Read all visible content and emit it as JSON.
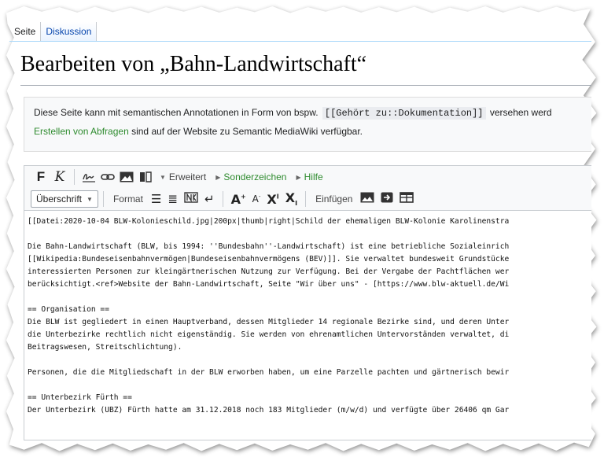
{
  "tabs": [
    {
      "label": "Seite"
    },
    {
      "label": "Diskussion"
    }
  ],
  "page_title": "Bearbeiten von „Bahn-Landwirtschaft“",
  "notice": {
    "line1_before": "Diese Seite kann mit semantischen Annotationen in Form von bspw.",
    "line1_code": "[[Gehört zu::Dokumentation]]",
    "line1_after": "versehen werd",
    "line2_link": "Erstellen von Abfragen",
    "line2_rest": "sind auf der Website zu Semantic MediaWiki verfügbar."
  },
  "toolbar": {
    "bold": "F",
    "italic": "K",
    "advanced": "Erweitert",
    "special_chars": "Sonderzeichen",
    "help": "Hilfe",
    "heading_select": "Überschrift",
    "format": "Format",
    "insert": "Einfügen"
  },
  "editor_lines": [
    "[[Datei:2020-10-04 BLW-Kolonieschild.jpg|200px|thumb|right|Schild der ehemaligen BLW-Kolonie Karolinenstra",
    "",
    "Die Bahn-Landwirtschaft (BLW, bis 1994: ''Bundesbahn''-Landwirtschaft) ist eine betriebliche Sozialeinrich",
    "[[Wikipedia:Bundeseisenbahnvermögen|Bundeseisenbahnvermögens (BEV)]]. Sie verwaltet bundesweit Grundstücke",
    "interessierten Personen zur kleingärtnerischen Nutzung zur Verfügung. Bei der Vergabe der Pachtflächen wer",
    "berücksichtigt.<ref>Website der Bahn-Landwirtschaft, Seite \"Wir über uns\" - [https://www.blw-aktuell.de/Wi",
    "",
    "== Organisation ==",
    "Die BLW ist gegliedert in einen Hauptverband, dessen Mitglieder 14 regionale Bezirke sind, und deren Unter",
    "die Unterbezirke rechtlich nicht eigenständig. Sie werden von ehrenamtlichen Untervorständen verwaltet, di",
    "Beitragswesen, Streitschlichtung).",
    "",
    "Personen, die die Mitgliedschaft in der BLW erworben haben, um eine Parzelle pachten und gärtnerisch bewir",
    "",
    "== Unterbezirk Fürth ==",
    "Der Unterbezirk (UBZ) Fürth hatte am 31.12.2018 noch 183 Mitglieder (m/w/d) und verfügte über 26406 qm Gar"
  ]
}
